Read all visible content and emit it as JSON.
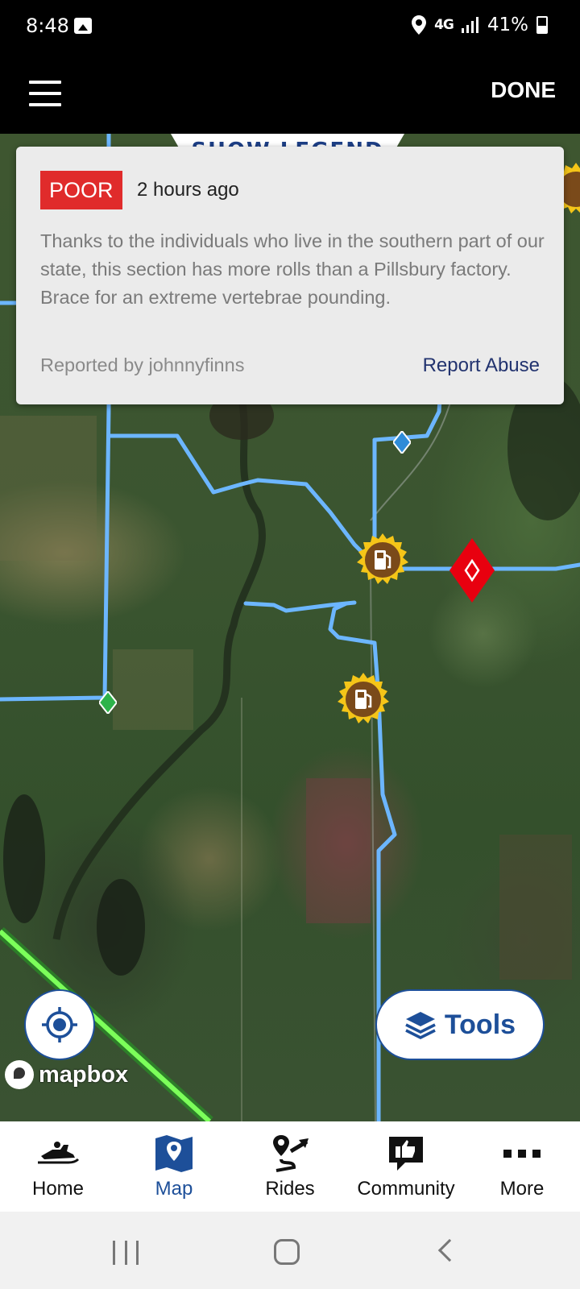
{
  "status_bar": {
    "time": "8:48",
    "network": "4G",
    "battery": "41%"
  },
  "header": {
    "done_label": "DONE"
  },
  "map": {
    "legend_tab_label": "SHOW LEGEND",
    "attribution": "mapbox",
    "tools_label": "Tools"
  },
  "report": {
    "condition": "POOR",
    "time_ago": "2 hours ago",
    "body": "Thanks to the individuals who live in the southern part of our state, this section has more rolls than a Pillsbury factory. Brace for an extreme vertebrae pounding.",
    "reported_by": "Reported by  johnnyfinns",
    "report_abuse_label": "Report Abuse"
  },
  "tabs": [
    {
      "label": "Home",
      "icon": "snowmobile-icon",
      "active": false
    },
    {
      "label": "Map",
      "icon": "map-icon",
      "active": true
    },
    {
      "label": "Rides",
      "icon": "route-icon",
      "active": false
    },
    {
      "label": "Community",
      "icon": "thumbs-up-icon",
      "active": false
    },
    {
      "label": "More",
      "icon": "more-icon",
      "active": false
    }
  ],
  "colors": {
    "accent": "#1d4f99",
    "poor": "#e02b2b",
    "trail": "#6cb6ff",
    "gas_marker": "#f5c518"
  }
}
